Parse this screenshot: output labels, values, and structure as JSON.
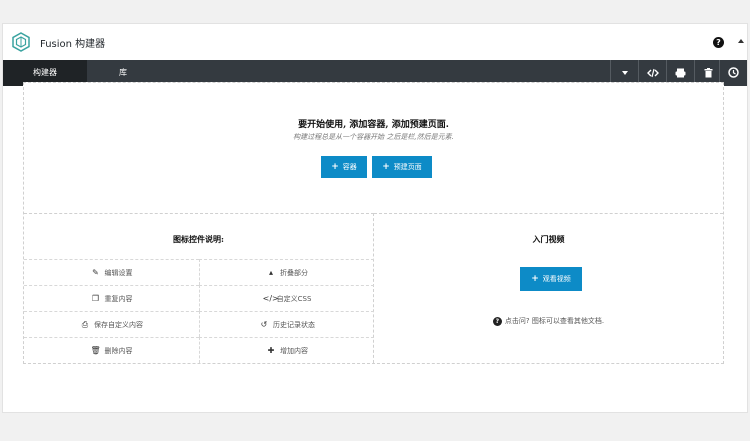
{
  "app": {
    "title": "Fusion 构建器",
    "accent": "#0d8bc7",
    "toolbar_bg": "#343a40",
    "help_icon": "help-icon",
    "collapse_icon": "caret-up-icon"
  },
  "tabs": [
    {
      "label": "构建器",
      "active": true
    },
    {
      "label": "库",
      "active": false
    }
  ],
  "toolbar_buttons": [
    {
      "icon": "chevron-down-icon"
    },
    {
      "icon": "code-icon"
    },
    {
      "icon": "save-icon"
    },
    {
      "icon": "trash-icon"
    },
    {
      "icon": "history-icon"
    }
  ],
  "intro": {
    "heading": "要开始使用, 添加容器, 添加预建页面.",
    "subtext": "构建过程总是从一个容器开始 之后是栏,然后是元素.",
    "add_container": "容器",
    "add_prebuilt": "预建页面"
  },
  "legend": {
    "title": "图标控件说明:",
    "items": [
      {
        "icon": "pencil-icon",
        "label": "编辑设置"
      },
      {
        "icon": "caret-up-icon",
        "label": "折叠部分"
      },
      {
        "icon": "clone-icon",
        "label": "重复内容"
      },
      {
        "icon": "code-icon",
        "label": "自定义CSS"
      },
      {
        "icon": "save-icon",
        "label": "保存自定义内容"
      },
      {
        "icon": "history-icon",
        "label": "历史记录状态"
      },
      {
        "icon": "trash-icon",
        "label": "删除内容"
      },
      {
        "icon": "plus-icon",
        "label": "增加内容"
      }
    ]
  },
  "video": {
    "title": "入门视频",
    "button": "观看视频",
    "docs_text": "点击问? 图标可以查看其他文档."
  }
}
